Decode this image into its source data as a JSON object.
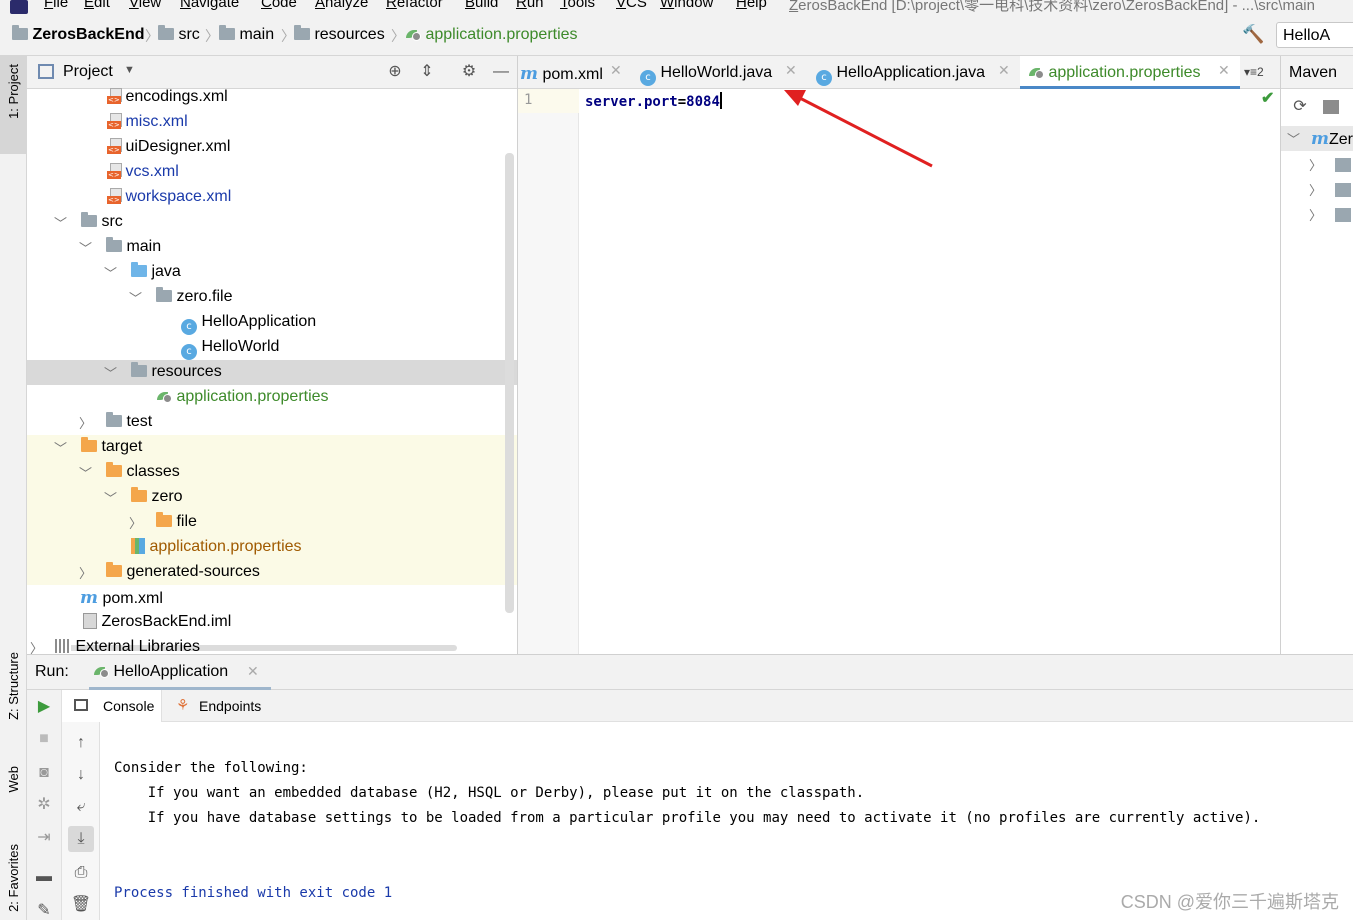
{
  "menu": [
    "File",
    "Edit",
    "View",
    "Navigate",
    "Code",
    "Analyze",
    "Refactor",
    "Build",
    "Run",
    "Tools",
    "VCS",
    "Window",
    "Help"
  ],
  "window_title": "ZerosBackEnd [D:\\project\\零一电科\\技术资料\\zero\\ZerosBackEnd] - ...\\src\\main",
  "breadcrumb": {
    "project": "ZerosBackEnd",
    "items": [
      "src",
      "main",
      "resources",
      "application.properties"
    ]
  },
  "run_config": "HelloA",
  "left_stripe": {
    "project": "1: Project",
    "structure": "Z: Structure",
    "web": "Web",
    "favorites": "2: Favorites"
  },
  "project_panel": {
    "title": "Project",
    "tree": [
      {
        "label": "encodings.xml",
        "icon": "xml-file-icon",
        "color": "#000000"
      },
      {
        "label": "misc.xml",
        "icon": "xml-file-icon",
        "color": "#1a3aaa"
      },
      {
        "label": "uiDesigner.xml",
        "icon": "xml-file-icon",
        "color": "#000000"
      },
      {
        "label": "vcs.xml",
        "icon": "xml-file-icon",
        "color": "#1a3aaa"
      },
      {
        "label": "workspace.xml",
        "icon": "xml-file-icon",
        "color": "#1a3aaa"
      },
      {
        "label": "src",
        "icon": "folder-icon",
        "color": "#000000"
      },
      {
        "label": "main",
        "icon": "folder-icon",
        "color": "#000000"
      },
      {
        "label": "java",
        "icon": "source-folder-icon",
        "color": "#000000"
      },
      {
        "label": "zero.file",
        "icon": "package-icon",
        "color": "#000000"
      },
      {
        "label": "HelloApplication",
        "icon": "spring-class-icon",
        "color": "#000000"
      },
      {
        "label": "HelloWorld",
        "icon": "class-icon",
        "color": "#000000"
      },
      {
        "label": "resources",
        "icon": "resources-folder-icon",
        "color": "#000000"
      },
      {
        "label": "application.properties",
        "icon": "spring-properties-icon",
        "color": "#3d8a2a"
      },
      {
        "label": "test",
        "icon": "folder-icon",
        "color": "#000000"
      },
      {
        "label": "target",
        "icon": "excluded-folder-icon",
        "color": "#000000"
      },
      {
        "label": "classes",
        "icon": "excluded-folder-icon",
        "color": "#000000"
      },
      {
        "label": "zero",
        "icon": "excluded-folder-icon",
        "color": "#000000"
      },
      {
        "label": "file",
        "icon": "excluded-folder-icon",
        "color": "#000000"
      },
      {
        "label": "application.properties",
        "icon": "properties-file-icon",
        "color": "#a05a00"
      },
      {
        "label": "generated-sources",
        "icon": "excluded-folder-icon",
        "color": "#000000"
      },
      {
        "label": "pom.xml",
        "icon": "maven-icon",
        "color": "#000000"
      },
      {
        "label": "ZerosBackEnd.iml",
        "icon": "iml-file-icon",
        "color": "#000000"
      },
      {
        "label": "External Libraries",
        "icon": "library-icon",
        "color": "#000000"
      }
    ]
  },
  "editor_tabs": [
    {
      "label": "pom.xml",
      "icon": "maven-icon"
    },
    {
      "label": "HelloWorld.java",
      "icon": "class-icon"
    },
    {
      "label": "HelloApplication.java",
      "icon": "spring-class-icon"
    },
    {
      "label": "application.properties",
      "icon": "spring-properties-icon",
      "active": true
    }
  ],
  "tab_overflow": "2",
  "editor": {
    "line_number": "1",
    "code_key": "server.port",
    "code_eq": "=",
    "code_value": "8084"
  },
  "maven_panel": {
    "title": "Maven",
    "root": "Zer"
  },
  "run_panel": {
    "label": "Run:",
    "config_tab": "HelloApplication",
    "tabs": [
      "Console",
      "Endpoints"
    ],
    "console_lines": [
      "Consider the following:",
      "    If you want an embedded database (H2, HSQL or Derby), please put it on the classpath.",
      "    If you have database settings to be loaded from a particular profile you may need to activate it (no profiles are currently active)."
    ],
    "exit_message": "Process finished with exit code 1"
  },
  "watermark": "CSDN @爱你三千遍斯塔克",
  "colors": {
    "accent_blue": "#4a88c7",
    "spring_green": "#3d8a2a",
    "arrow_red": "#e02020",
    "excluded_bg": "#fbfae6"
  }
}
